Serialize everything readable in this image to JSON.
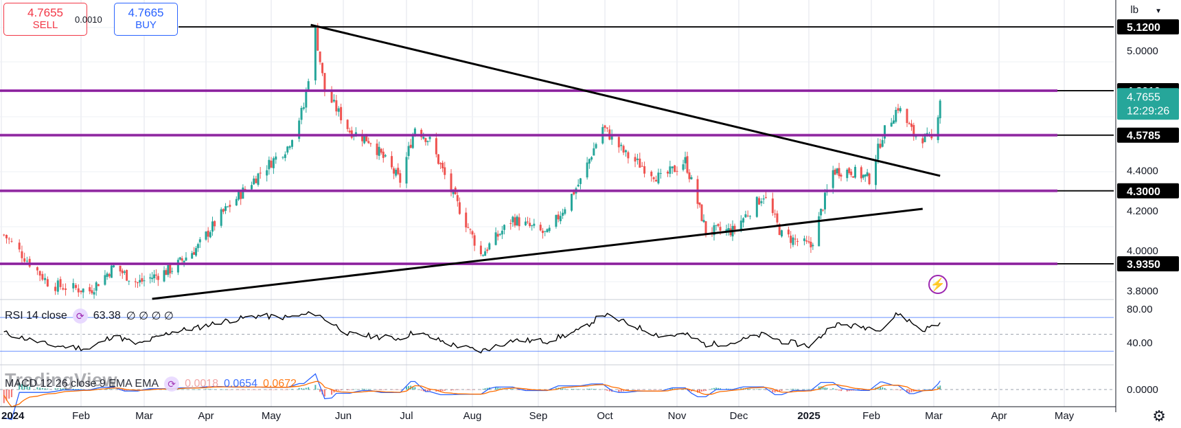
{
  "quote": {
    "sell_price": "4.7655",
    "sell_label": "SELL",
    "buy_price": "4.7665",
    "buy_label": "BUY",
    "spread": "0.0010"
  },
  "unit_label": "lb",
  "colors": {
    "up": "#26a69a",
    "down": "#ef5350",
    "level": "#9c27b0",
    "current": "#26a69a",
    "rsi": "#000000",
    "macd": "#2962ff",
    "signal": "#ff6d00"
  },
  "icons": [
    "flash-icon",
    "settings-icon",
    "chevron-down-icon",
    "gear-icon"
  ],
  "chart_data": {
    "type": "candlestick",
    "instrument_unit": "lb",
    "price_axis": {
      "range": [
        3.76,
        5.22
      ],
      "ticks": [
        "5.0000",
        "4.4000",
        "4.2000",
        "4.0000",
        "3.8000"
      ]
    },
    "time_axis": {
      "labels": [
        "2024",
        "Feb",
        "Mar",
        "Apr",
        "May",
        "Jun",
        "Jul",
        "Aug",
        "Sep",
        "Oct",
        "Nov",
        "Dec",
        "2025",
        "Feb",
        "Mar",
        "Apr",
        "May"
      ]
    },
    "close_path": [
      [
        "2024-01-02",
        4.08
      ],
      [
        "2024-01-20",
        3.83
      ],
      [
        "2024-02-05",
        3.8
      ],
      [
        "2024-02-16",
        3.92
      ],
      [
        "2024-02-27",
        3.84
      ],
      [
        "2024-03-15",
        3.91
      ],
      [
        "2024-03-28",
        4.02
      ],
      [
        "2024-04-08",
        4.18
      ],
      [
        "2024-04-25",
        4.38
      ],
      [
        "2024-05-08",
        4.52
      ],
      [
        "2024-05-15",
        4.72
      ],
      [
        "2024-05-20",
        5.1
      ],
      [
        "2024-05-24",
        4.8
      ],
      [
        "2024-06-04",
        4.6
      ],
      [
        "2024-06-14",
        4.55
      ],
      [
        "2024-06-28",
        4.35
      ],
      [
        "2024-07-05",
        4.62
      ],
      [
        "2024-07-12",
        4.55
      ],
      [
        "2024-07-22",
        4.3
      ],
      [
        "2024-08-05",
        3.98
      ],
      [
        "2024-08-20",
        4.16
      ],
      [
        "2024-09-05",
        4.08
      ],
      [
        "2024-09-20",
        4.35
      ],
      [
        "2024-09-30",
        4.62
      ],
      [
        "2024-10-10",
        4.48
      ],
      [
        "2024-10-25",
        4.36
      ],
      [
        "2024-11-05",
        4.45
      ],
      [
        "2024-11-15",
        4.1
      ],
      [
        "2024-11-28",
        4.1
      ],
      [
        "2024-12-12",
        4.28
      ],
      [
        "2024-12-20",
        4.08
      ],
      [
        "2025-01-02",
        4.02
      ],
      [
        "2025-01-13",
        4.4
      ],
      [
        "2025-01-22",
        4.4
      ],
      [
        "2025-01-31",
        4.36
      ],
      [
        "2025-02-06",
        4.58
      ],
      [
        "2025-02-13",
        4.72
      ],
      [
        "2025-02-20",
        4.58
      ],
      [
        "2025-03-01",
        4.55
      ],
      [
        "2025-03-04",
        4.7655
      ]
    ],
    "horizontal_levels": [
      {
        "price": 5.12,
        "label": "5.1200",
        "style": "black"
      },
      {
        "price": 4.801,
        "label": "4.8010",
        "style": "purple"
      },
      {
        "price": 4.5785,
        "label": "4.5785",
        "style": "purple"
      },
      {
        "price": 4.3,
        "label": "4.3000",
        "style": "purple"
      },
      {
        "price": 3.935,
        "label": "3.9350",
        "style": "purple"
      }
    ],
    "trendlines": [
      {
        "from": [
          "2024-05-18",
          5.13
        ],
        "to": [
          "2025-03-04",
          4.375
        ]
      },
      {
        "from": [
          "2024-03-05",
          3.76
        ],
        "to": [
          "2025-02-24",
          4.21
        ]
      }
    ],
    "last_price": {
      "value": "4.7655",
      "countdown": "12:29:26"
    },
    "rsi": {
      "label": "RSI 14 close",
      "value": "63.38",
      "extra": "∅ ∅ ∅ ∅",
      "ticks": [
        "80.00",
        "40.00"
      ],
      "bands": [
        70,
        30
      ],
      "mid": 50,
      "path": [
        [
          "2024-01-02",
          52
        ],
        [
          "2024-01-20",
          37
        ],
        [
          "2024-02-05",
          33
        ],
        [
          "2024-02-16",
          49
        ],
        [
          "2024-02-27",
          38
        ],
        [
          "2024-03-15",
          53
        ],
        [
          "2024-03-28",
          58
        ],
        [
          "2024-04-08",
          65
        ],
        [
          "2024-04-25",
          72
        ],
        [
          "2024-05-08",
          70
        ],
        [
          "2024-05-20",
          75
        ],
        [
          "2024-06-04",
          50
        ],
        [
          "2024-06-28",
          45
        ],
        [
          "2024-07-05",
          53
        ],
        [
          "2024-07-22",
          38
        ],
        [
          "2024-08-05",
          30
        ],
        [
          "2024-08-20",
          43
        ],
        [
          "2024-09-05",
          42
        ],
        [
          "2024-09-20",
          55
        ],
        [
          "2024-09-30",
          74
        ],
        [
          "2024-10-25",
          48
        ],
        [
          "2024-11-05",
          50
        ],
        [
          "2024-11-15",
          38
        ],
        [
          "2024-11-28",
          40
        ],
        [
          "2024-12-12",
          50
        ],
        [
          "2024-12-20",
          42
        ],
        [
          "2025-01-02",
          36
        ],
        [
          "2025-01-13",
          62
        ],
        [
          "2025-01-22",
          60
        ],
        [
          "2025-02-06",
          57
        ],
        [
          "2025-02-13",
          75
        ],
        [
          "2025-02-24",
          55
        ],
        [
          "2025-03-04",
          63.38
        ]
      ]
    },
    "macd": {
      "label": "MACD 12 26 close 9 EMA EMA",
      "histogram": "0.0018",
      "macd": "0.0654",
      "signal": "0.0672",
      "ticks": [
        "0.0000"
      ]
    }
  },
  "watermark": "TradingView"
}
